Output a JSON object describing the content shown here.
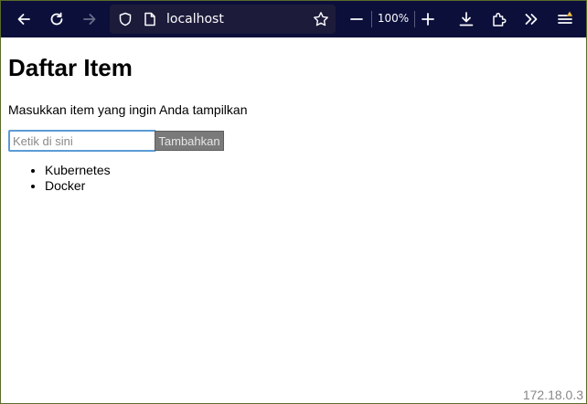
{
  "browser": {
    "url": "localhost",
    "zoom": "100%",
    "icons": {
      "back": "arrow-left-icon",
      "reload": "reload-icon",
      "forward": "arrow-right-icon",
      "shield": "shield-icon",
      "page": "page-icon",
      "bookmark": "star-icon",
      "zoom_out": "minus-icon",
      "zoom_in": "plus-icon",
      "downloads": "download-icon",
      "extensions": "puzzle-icon",
      "overflow": "chevrons-right-icon",
      "menu": "hamburger-icon"
    },
    "colors": {
      "toolbar_bg": "#0b0f3a",
      "urlbar_bg": "#1c1b3a",
      "menu_badge": "#f0c040"
    }
  },
  "page": {
    "title": "Daftar Item",
    "description": "Masukkan item yang ingin Anda tampilkan",
    "input": {
      "placeholder": "Ketik di sini",
      "value": ""
    },
    "add_button_label": "Tambahkan",
    "items": [
      "Kubernetes",
      "Docker"
    ],
    "footer_ip": "172.18.0.3"
  }
}
